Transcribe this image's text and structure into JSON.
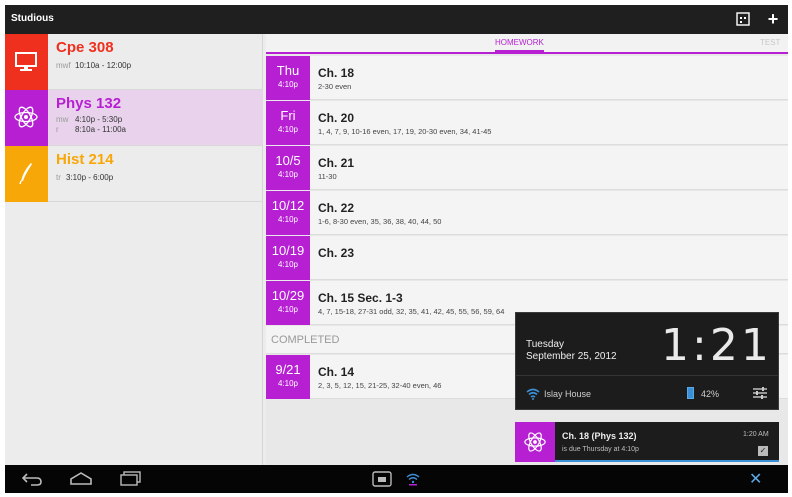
{
  "app": {
    "title": "Studious"
  },
  "colors": {
    "cpe": "#f0301f",
    "phys": "#b61fd2",
    "hist": "#f7a708",
    "accent": "#b61fd2"
  },
  "courses": [
    {
      "name": "Cpe 308",
      "icon": "monitor-icon",
      "schedule": [
        {
          "days": "mwf",
          "time": "10:10a - 12:00p"
        }
      ]
    },
    {
      "name": "Phys 132",
      "icon": "atom-icon",
      "schedule": [
        {
          "days": "mw",
          "time": "4:10p - 5:30p"
        },
        {
          "days": "r",
          "time": "8:10a - 11:00a"
        }
      ]
    },
    {
      "name": "Hist 214",
      "icon": "quill-icon",
      "schedule": [
        {
          "days": "tr",
          "time": "3:10p - 6:00p"
        }
      ]
    }
  ],
  "tabs": {
    "homework": "HOMEWORK",
    "tests": "TEST"
  },
  "homework": [
    {
      "day": "Thu",
      "time": "4:10p",
      "title": "Ch. 18",
      "desc": "2-30 even"
    },
    {
      "day": "Fri",
      "time": "4:10p",
      "title": "Ch. 20",
      "desc": "1, 4, 7, 9, 10-16 even, 17, 19, 20-30 even, 34, 41-45"
    },
    {
      "day": "10/5",
      "time": "4:10p",
      "title": "Ch. 21",
      "desc": "11-30"
    },
    {
      "day": "10/12",
      "time": "4:10p",
      "title": "Ch. 22",
      "desc": "1-6, 8-30 even, 35, 36, 38, 40, 44, 50"
    },
    {
      "day": "10/19",
      "time": "4:10p",
      "title": "Ch. 23",
      "desc": ""
    },
    {
      "day": "10/29",
      "time": "4:10p",
      "title": "Ch. 15 Sec. 1-3",
      "desc": "4, 7, 15-18, 27-31 odd, 32, 35, 41, 42, 45, 55, 56, 59, 64"
    }
  ],
  "completed": {
    "label": "COMPLETED",
    "items": [
      {
        "day": "9/21",
        "time": "4:10p",
        "title": "Ch. 14",
        "desc": "2, 3, 5, 12, 15, 21-25, 32-40 even, 46"
      }
    ]
  },
  "shade": {
    "day": "Tuesday",
    "date": "September 25, 2012",
    "clock": "1:21",
    "wifi": "Islay House",
    "battery": "42%"
  },
  "notification": {
    "title": "Ch. 18 (Phys 132)",
    "text": "is due Thursday at 4:10p",
    "time": "1:20 AM"
  }
}
